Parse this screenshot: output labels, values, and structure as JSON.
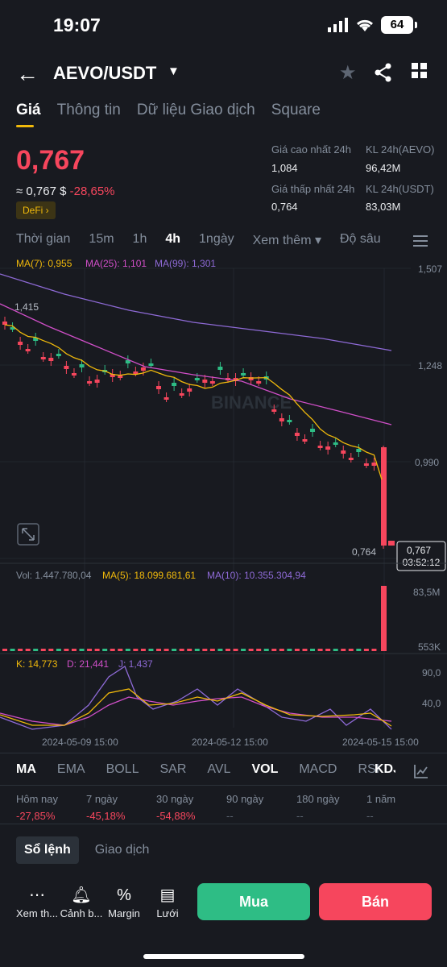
{
  "status": {
    "time": "19:07",
    "battery": "64"
  },
  "header": {
    "pair": "AEVO/USDT"
  },
  "tabs": [
    "Giá",
    "Thông tin",
    "Dữ liệu Giao dịch",
    "Square"
  ],
  "ticker": {
    "price": "0,767",
    "approx": "≈ 0,767 $",
    "change": "-28,65%",
    "tag": "DeFi ›",
    "high_label": "Giá cao nhất 24h",
    "high": "1,084",
    "low_label": "Giá thấp nhất 24h",
    "low": "0,764",
    "vol_base_label": "KL 24h(AEVO)",
    "vol_base": "96,42M",
    "vol_quote_label": "KL 24h(USDT)",
    "vol_quote": "83,03M"
  },
  "intervals": [
    "Thời gian",
    "15m",
    "1h",
    "4h",
    "1ngày",
    "Xem thêm ▾",
    "Độ sâu"
  ],
  "ma_legend": {
    "ma7": "MA(7): 0,955",
    "ma25": "MA(25): 1,101",
    "ma99": "MA(99): 1,301"
  },
  "vol_legend": {
    "vol": "Vol: 1.447.780,04",
    "ma5": "MA(5): 18.099.681,61",
    "ma10": "MA(10): 10.355.304,94"
  },
  "kdj_legend": {
    "k": "K: 14,773",
    "d": "D: 21,441",
    "j": "J: 1,437"
  },
  "chart_data": {
    "type": "candlestick",
    "price_axis": [
      "1,507",
      "1,248",
      "0,990"
    ],
    "high_marker": "1,415",
    "low_marker": "0,764",
    "last_price": "0,767",
    "countdown": "03:52:12",
    "volume_axis": [
      "83,5M",
      "553K"
    ],
    "kdj_axis": [
      "90,0",
      "40,0"
    ],
    "dates": [
      "2024-05-09 15:00",
      "2024-05-12 15:00",
      "2024-05-15 15:00"
    ],
    "watermark": "BINANCE",
    "colors": {
      "up": "#2ebd85",
      "down": "#f6465d",
      "ma7": "#f0b90b",
      "ma25": "#d04fc8",
      "ma99": "#8e6ad6"
    }
  },
  "indicators": [
    "MA",
    "EMA",
    "BOLL",
    "SAR",
    "AVL",
    "VOL",
    "MACD",
    "RSI",
    "KDJ"
  ],
  "performance": [
    {
      "label": "Hôm nay",
      "value": "-27,85%"
    },
    {
      "label": "7 ngày",
      "value": "-45,18%"
    },
    {
      "label": "30 ngày",
      "value": "-54,88%"
    },
    {
      "label": "90 ngày",
      "value": "--"
    },
    {
      "label": "180 ngày",
      "value": "--"
    },
    {
      "label": "1 năm",
      "value": "--"
    }
  ],
  "book_tabs": [
    "Sổ lệnh",
    "Giao dịch"
  ],
  "bottom": {
    "more": "Xem th...",
    "alert": "Cảnh b...",
    "margin": "Margin",
    "grid": "Lưới",
    "buy": "Mua",
    "sell": "Bán"
  }
}
